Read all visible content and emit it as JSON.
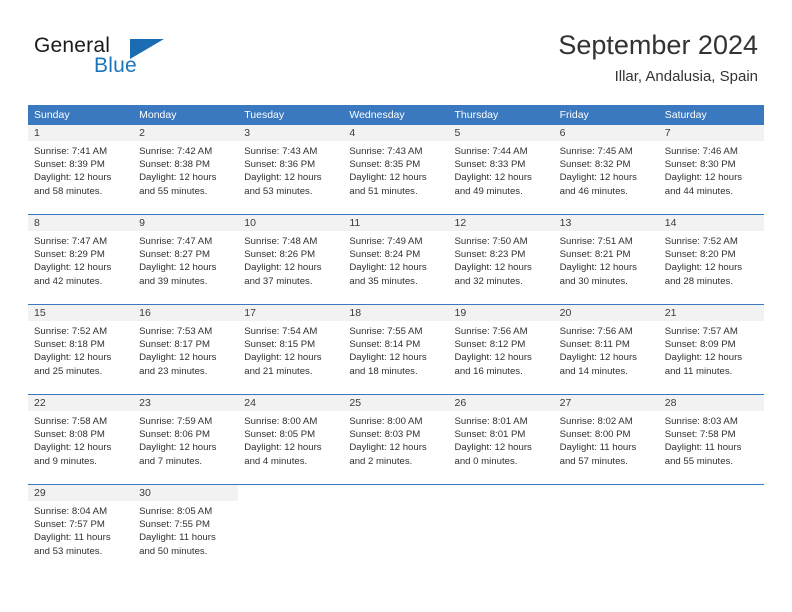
{
  "brand": {
    "name_part1": "General",
    "name_part2": "Blue"
  },
  "header": {
    "month_title": "September 2024",
    "location": "Illar, Andalusia, Spain"
  },
  "weekdays": [
    "Sunday",
    "Monday",
    "Tuesday",
    "Wednesday",
    "Thursday",
    "Friday",
    "Saturday"
  ],
  "colors": {
    "header_blue": "#3a78bf",
    "logo_blue": "#1b75bb",
    "daynum_band": "#f2f2f2"
  },
  "weeks": [
    [
      {
        "day": "1",
        "sunrise": "Sunrise: 7:41 AM",
        "sunset": "Sunset: 8:39 PM",
        "daylight1": "Daylight: 12 hours",
        "daylight2": "and 58 minutes."
      },
      {
        "day": "2",
        "sunrise": "Sunrise: 7:42 AM",
        "sunset": "Sunset: 8:38 PM",
        "daylight1": "Daylight: 12 hours",
        "daylight2": "and 55 minutes."
      },
      {
        "day": "3",
        "sunrise": "Sunrise: 7:43 AM",
        "sunset": "Sunset: 8:36 PM",
        "daylight1": "Daylight: 12 hours",
        "daylight2": "and 53 minutes."
      },
      {
        "day": "4",
        "sunrise": "Sunrise: 7:43 AM",
        "sunset": "Sunset: 8:35 PM",
        "daylight1": "Daylight: 12 hours",
        "daylight2": "and 51 minutes."
      },
      {
        "day": "5",
        "sunrise": "Sunrise: 7:44 AM",
        "sunset": "Sunset: 8:33 PM",
        "daylight1": "Daylight: 12 hours",
        "daylight2": "and 49 minutes."
      },
      {
        "day": "6",
        "sunrise": "Sunrise: 7:45 AM",
        "sunset": "Sunset: 8:32 PM",
        "daylight1": "Daylight: 12 hours",
        "daylight2": "and 46 minutes."
      },
      {
        "day": "7",
        "sunrise": "Sunrise: 7:46 AM",
        "sunset": "Sunset: 8:30 PM",
        "daylight1": "Daylight: 12 hours",
        "daylight2": "and 44 minutes."
      }
    ],
    [
      {
        "day": "8",
        "sunrise": "Sunrise: 7:47 AM",
        "sunset": "Sunset: 8:29 PM",
        "daylight1": "Daylight: 12 hours",
        "daylight2": "and 42 minutes."
      },
      {
        "day": "9",
        "sunrise": "Sunrise: 7:47 AM",
        "sunset": "Sunset: 8:27 PM",
        "daylight1": "Daylight: 12 hours",
        "daylight2": "and 39 minutes."
      },
      {
        "day": "10",
        "sunrise": "Sunrise: 7:48 AM",
        "sunset": "Sunset: 8:26 PM",
        "daylight1": "Daylight: 12 hours",
        "daylight2": "and 37 minutes."
      },
      {
        "day": "11",
        "sunrise": "Sunrise: 7:49 AM",
        "sunset": "Sunset: 8:24 PM",
        "daylight1": "Daylight: 12 hours",
        "daylight2": "and 35 minutes."
      },
      {
        "day": "12",
        "sunrise": "Sunrise: 7:50 AM",
        "sunset": "Sunset: 8:23 PM",
        "daylight1": "Daylight: 12 hours",
        "daylight2": "and 32 minutes."
      },
      {
        "day": "13",
        "sunrise": "Sunrise: 7:51 AM",
        "sunset": "Sunset: 8:21 PM",
        "daylight1": "Daylight: 12 hours",
        "daylight2": "and 30 minutes."
      },
      {
        "day": "14",
        "sunrise": "Sunrise: 7:52 AM",
        "sunset": "Sunset: 8:20 PM",
        "daylight1": "Daylight: 12 hours",
        "daylight2": "and 28 minutes."
      }
    ],
    [
      {
        "day": "15",
        "sunrise": "Sunrise: 7:52 AM",
        "sunset": "Sunset: 8:18 PM",
        "daylight1": "Daylight: 12 hours",
        "daylight2": "and 25 minutes."
      },
      {
        "day": "16",
        "sunrise": "Sunrise: 7:53 AM",
        "sunset": "Sunset: 8:17 PM",
        "daylight1": "Daylight: 12 hours",
        "daylight2": "and 23 minutes."
      },
      {
        "day": "17",
        "sunrise": "Sunrise: 7:54 AM",
        "sunset": "Sunset: 8:15 PM",
        "daylight1": "Daylight: 12 hours",
        "daylight2": "and 21 minutes."
      },
      {
        "day": "18",
        "sunrise": "Sunrise: 7:55 AM",
        "sunset": "Sunset: 8:14 PM",
        "daylight1": "Daylight: 12 hours",
        "daylight2": "and 18 minutes."
      },
      {
        "day": "19",
        "sunrise": "Sunrise: 7:56 AM",
        "sunset": "Sunset: 8:12 PM",
        "daylight1": "Daylight: 12 hours",
        "daylight2": "and 16 minutes."
      },
      {
        "day": "20",
        "sunrise": "Sunrise: 7:56 AM",
        "sunset": "Sunset: 8:11 PM",
        "daylight1": "Daylight: 12 hours",
        "daylight2": "and 14 minutes."
      },
      {
        "day": "21",
        "sunrise": "Sunrise: 7:57 AM",
        "sunset": "Sunset: 8:09 PM",
        "daylight1": "Daylight: 12 hours",
        "daylight2": "and 11 minutes."
      }
    ],
    [
      {
        "day": "22",
        "sunrise": "Sunrise: 7:58 AM",
        "sunset": "Sunset: 8:08 PM",
        "daylight1": "Daylight: 12 hours",
        "daylight2": "and 9 minutes."
      },
      {
        "day": "23",
        "sunrise": "Sunrise: 7:59 AM",
        "sunset": "Sunset: 8:06 PM",
        "daylight1": "Daylight: 12 hours",
        "daylight2": "and 7 minutes."
      },
      {
        "day": "24",
        "sunrise": "Sunrise: 8:00 AM",
        "sunset": "Sunset: 8:05 PM",
        "daylight1": "Daylight: 12 hours",
        "daylight2": "and 4 minutes."
      },
      {
        "day": "25",
        "sunrise": "Sunrise: 8:00 AM",
        "sunset": "Sunset: 8:03 PM",
        "daylight1": "Daylight: 12 hours",
        "daylight2": "and 2 minutes."
      },
      {
        "day": "26",
        "sunrise": "Sunrise: 8:01 AM",
        "sunset": "Sunset: 8:01 PM",
        "daylight1": "Daylight: 12 hours",
        "daylight2": "and 0 minutes."
      },
      {
        "day": "27",
        "sunrise": "Sunrise: 8:02 AM",
        "sunset": "Sunset: 8:00 PM",
        "daylight1": "Daylight: 11 hours",
        "daylight2": "and 57 minutes."
      },
      {
        "day": "28",
        "sunrise": "Sunrise: 8:03 AM",
        "sunset": "Sunset: 7:58 PM",
        "daylight1": "Daylight: 11 hours",
        "daylight2": "and 55 minutes."
      }
    ],
    [
      {
        "day": "29",
        "sunrise": "Sunrise: 8:04 AM",
        "sunset": "Sunset: 7:57 PM",
        "daylight1": "Daylight: 11 hours",
        "daylight2": "and 53 minutes."
      },
      {
        "day": "30",
        "sunrise": "Sunrise: 8:05 AM",
        "sunset": "Sunset: 7:55 PM",
        "daylight1": "Daylight: 11 hours",
        "daylight2": "and 50 minutes."
      },
      {
        "day": "",
        "sunrise": "",
        "sunset": "",
        "daylight1": "",
        "daylight2": ""
      },
      {
        "day": "",
        "sunrise": "",
        "sunset": "",
        "daylight1": "",
        "daylight2": ""
      },
      {
        "day": "",
        "sunrise": "",
        "sunset": "",
        "daylight1": "",
        "daylight2": ""
      },
      {
        "day": "",
        "sunrise": "",
        "sunset": "",
        "daylight1": "",
        "daylight2": ""
      },
      {
        "day": "",
        "sunrise": "",
        "sunset": "",
        "daylight1": "",
        "daylight2": ""
      }
    ]
  ]
}
